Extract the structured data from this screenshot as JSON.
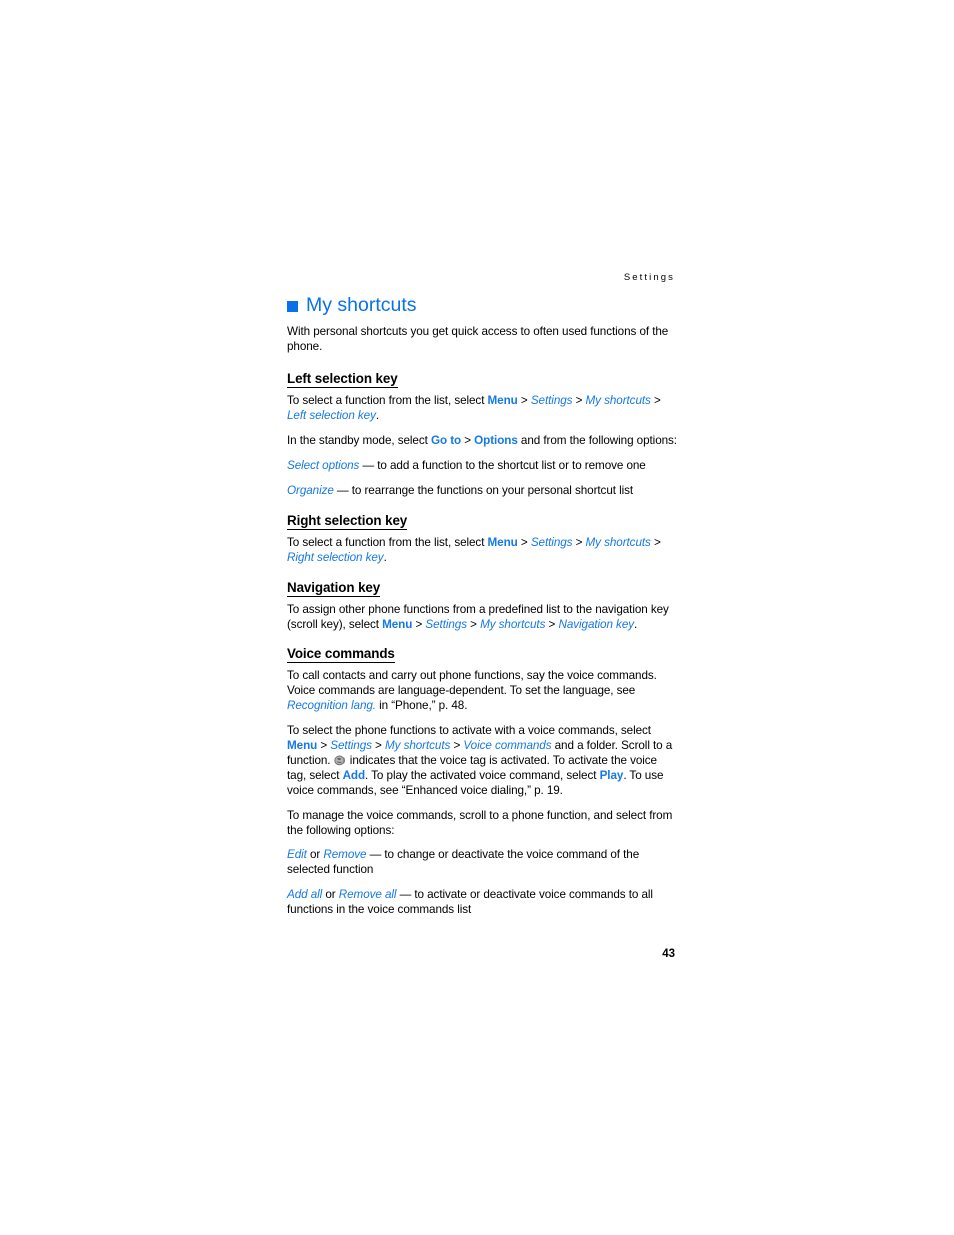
{
  "document": {
    "running_head": "Settings",
    "page_number": "43",
    "accent_color": "#0a72e8",
    "link_color": "#1579e6",
    "text_color": "#000000"
  },
  "chapter": {
    "bullet_icon": "square-bullet-icon",
    "title": "My shortcuts",
    "intro": "With personal shortcuts you get quick access to often used functions of the phone."
  },
  "sections": {
    "left_selection_key": {
      "heading": "Left selection key",
      "p1": {
        "lead": "To select a function from the list, select ",
        "menu": "Menu",
        "sep1": " > ",
        "settings": "Settings",
        "sep2": " > ",
        "my_shortcuts": "My shortcuts",
        "sep3": " > ",
        "target": "Left selection key",
        "tail": "."
      },
      "p2": {
        "lead": "In the standby mode, select ",
        "go_to": "Go to",
        "sep1": " > ",
        "options": "Options",
        "tail": " and from the following options:"
      },
      "option_select": {
        "term": "Select options",
        "desc": " — to add a function to the shortcut list or to remove one"
      },
      "option_organize": {
        "term": "Organize",
        "desc": " — to rearrange the functions on your personal shortcut list"
      }
    },
    "right_selection_key": {
      "heading": "Right selection key",
      "p1": {
        "lead": "To select a function from the list, select ",
        "menu": "Menu",
        "sep1": " > ",
        "settings": "Settings",
        "sep2": " > ",
        "my_shortcuts": "My shortcuts",
        "sep3": " > ",
        "target": "Right selection key",
        "tail": "."
      }
    },
    "navigation_key": {
      "heading": "Navigation key",
      "p1": {
        "lead": "To assign other phone functions from a predefined list to the navigation key (scroll key), select ",
        "menu": "Menu",
        "sep1": " > ",
        "settings": "Settings",
        "sep2": " > ",
        "my_shortcuts": "My shortcuts",
        "sep3": " > ",
        "target": "Navigation key",
        "tail": "."
      }
    },
    "voice_commands": {
      "heading": "Voice commands",
      "p1": {
        "lead": "To call contacts and carry out phone functions, say the voice commands. Voice commands are language-dependent. To set the language, see ",
        "recognition_lang": "Recognition lang.",
        "tail": " in “Phone,” p. 48."
      },
      "p2": {
        "lead": "To select the phone functions to activate with a voice commands, select ",
        "menu": "Menu",
        "sep1": " > ",
        "settings": "Settings",
        "sep2": " > ",
        "my_shortcuts": "My shortcuts",
        "sep3": " > ",
        "voice_commands": "Voice commands",
        "mid1": " and a folder. Scroll to a function. ",
        "icon": "voice-tag-icon",
        "mid2": " indicates that the voice tag is activated. To activate the voice tag, select ",
        "add": "Add",
        "mid3": ". To play the activated voice command, select ",
        "play": "Play",
        "tail": ". To use voice commands, see “Enhanced voice dialing,” p. 19."
      },
      "p3": "To manage the voice commands, scroll to a phone function, and select from the following options:",
      "option_edit": {
        "term1": "Edit",
        "conj": " or ",
        "term2": "Remove",
        "desc": " — to change or deactivate the voice command of the selected function"
      },
      "option_add_all": {
        "term1": "Add all",
        "conj": " or ",
        "term2": "Remove all",
        "desc": " — to activate or deactivate voice commands to all functions in the voice commands list"
      }
    }
  }
}
